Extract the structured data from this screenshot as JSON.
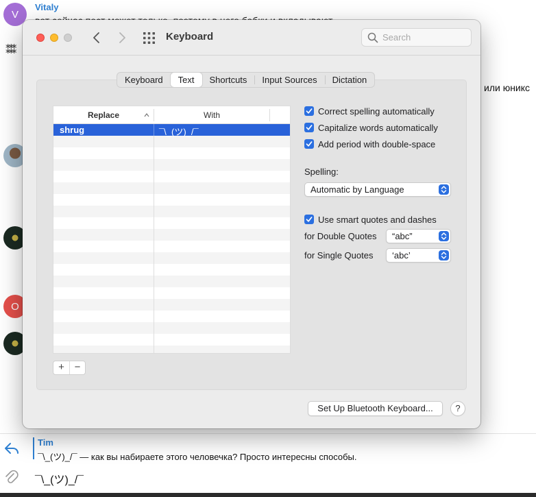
{
  "chat": {
    "vitaly": {
      "avatar_letter": "V",
      "avatar_color": "#a46ed6",
      "author": "Vitaly",
      "text": "вот сейчас пост может только, поэтому в него бабки и вкладывают"
    },
    "partial_right_text": "или юникс",
    "squiggle": "⁑⁑⁑",
    "o_avatar_letter": "O",
    "o_avatar_color": "#e5504b"
  },
  "reply": {
    "author": "Tim",
    "text": "¯\\_(ツ)_/¯ — как вы набираете этого человечка? Просто интересны способы."
  },
  "input": {
    "value": "¯\\_(ツ)_/¯"
  },
  "window": {
    "title": "Keyboard",
    "search_placeholder": "Search"
  },
  "tabs": [
    {
      "label": "Keyboard",
      "active": false
    },
    {
      "label": "Text",
      "active": true
    },
    {
      "label": "Shortcuts",
      "active": false
    },
    {
      "label": "Input Sources",
      "active": false
    },
    {
      "label": "Dictation",
      "active": false
    }
  ],
  "table": {
    "header_replace": "Replace",
    "header_with": "With",
    "rows": [
      {
        "replace": "shrug",
        "with": "¯\\_(ツ)_/¯",
        "selected": true
      }
    ]
  },
  "buttons": {
    "add": "+",
    "remove": "−",
    "bluetooth": "Set Up Bluetooth Keyboard...",
    "help": "?"
  },
  "options": {
    "correct_spelling": "Correct spelling automatically",
    "capitalize_words": "Capitalize words automatically",
    "add_period": "Add period with double-space",
    "spelling_label": "Spelling:",
    "spelling_value": "Automatic by Language",
    "smart_quotes": "Use smart quotes and dashes",
    "double_quotes_label": "for Double Quotes",
    "double_quotes_value": "“abc”",
    "single_quotes_label": "for Single Quotes",
    "single_quotes_value": "‘abc’"
  },
  "colors": {
    "accent": "#2b6fe0",
    "selection": "#2962d9",
    "chat_link": "#2f81d3"
  }
}
